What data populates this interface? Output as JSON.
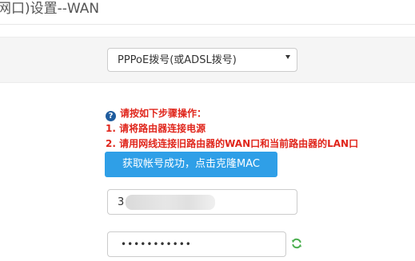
{
  "page": {
    "title": "网口)设置--WAN"
  },
  "connection": {
    "selected": "PPPoE拨号(或ADSL拨号)"
  },
  "instructions": {
    "heading": "请按如下步骤操作：",
    "steps": [
      "1. 请将路由器连接电源",
      "2. 请用网线连接旧路由器的WAN口和当前路由器的LAN口"
    ]
  },
  "mac_button": {
    "label": "获取帐号成功，点击克隆MAC"
  },
  "account": {
    "value_visible": "3"
  },
  "password": {
    "masked": "•••••••••••"
  },
  "colors": {
    "accent": "#2f9fe7",
    "warning": "#e0261c",
    "help_icon": "#1f5c9e",
    "refresh_icon": "#4caf50"
  },
  "icons": {
    "help": "question-circle-icon",
    "dropdown": "chevron-down-icon",
    "refresh": "refresh-icon"
  }
}
